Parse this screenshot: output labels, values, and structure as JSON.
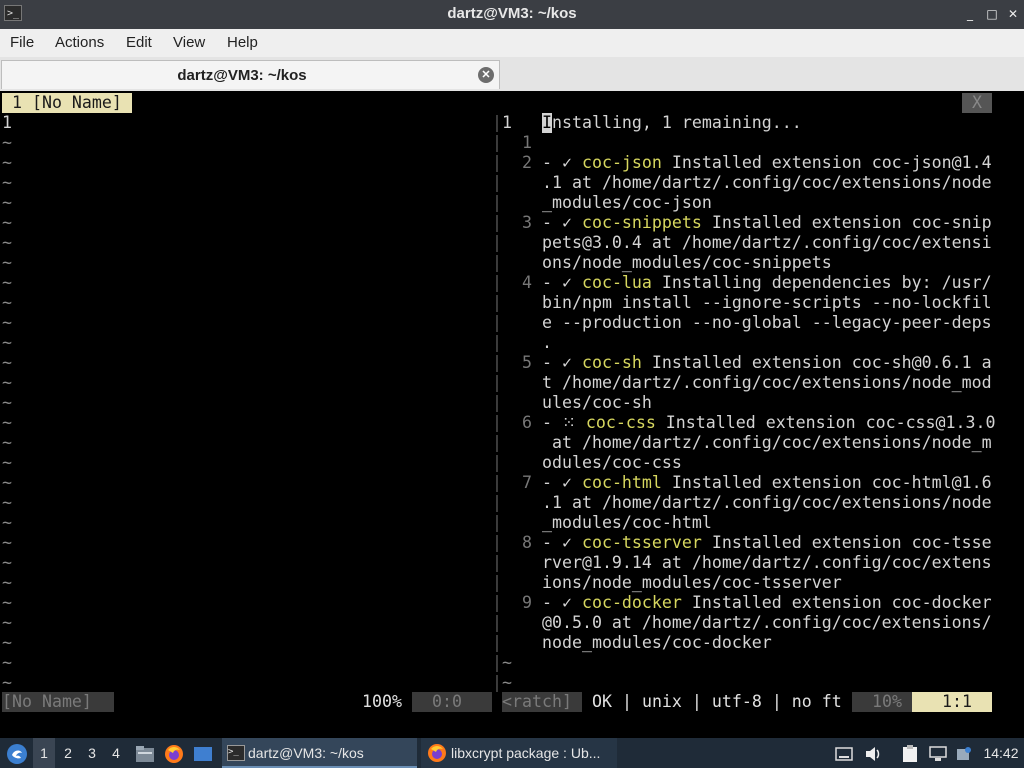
{
  "window": {
    "title": "dartz@VM3: ~/kos",
    "app_icon": "terminal-icon",
    "buttons": {
      "minimize": "_",
      "maximize": "□",
      "close": "✕"
    }
  },
  "menu": [
    "File",
    "Actions",
    "Edit",
    "View",
    "Help"
  ],
  "tab": {
    "label": "dartz@VM3: ~/kos",
    "close": "✕"
  },
  "vim": {
    "tabline": {
      "active": " 1 [No Name] ",
      "close": "X"
    },
    "left_first_line": "1",
    "tilde": "~",
    "sep": "|",
    "right_lines": [
      {
        "num": "1",
        "text": "nstalling, 1 remaining...",
        "cursor_char": "I"
      },
      {
        "num": "1"
      },
      {
        "num": "2",
        "ext": "coc-json",
        "rest1": " Installed extension coc-json@1.4",
        "cont": [
          ".1 at /home/dartz/.config/coc/extensions/node",
          "_modules/coc-json"
        ]
      },
      {
        "num": "3",
        "ext": "coc-snippets",
        "rest1": " Installed extension coc-snip",
        "cont": [
          "pets@3.0.4 at /home/dartz/.config/coc/extensi",
          "ons/node_modules/coc-snippets"
        ]
      },
      {
        "num": "4",
        "ext": "coc-lua",
        "rest1": " Installing dependencies by: /usr/",
        "cont": [
          "bin/npm install --ignore-scripts --no-lockfil",
          "e --production --no-global --legacy-peer-deps",
          "."
        ]
      },
      {
        "num": "5",
        "ext": "coc-sh",
        "rest1": " Installed extension coc-sh@0.6.1 a",
        "cont": [
          "t /home/dartz/.config/coc/extensions/node_mod",
          "ules/coc-sh"
        ]
      },
      {
        "num": "6",
        "ext": "coc-css",
        "rest1": " Installed extension coc-css@1.3.0",
        "cont": [
          " at /home/dartz/.config/coc/extensions/node_m",
          "odules/coc-css"
        ]
      },
      {
        "num": "7",
        "ext": "coc-html",
        "rest1": " Installed extension coc-html@1.6",
        "cont": [
          ".1 at /home/dartz/.config/coc/extensions/node",
          "_modules/coc-html"
        ]
      },
      {
        "num": "8",
        "ext": "coc-tsserver",
        "rest1": " Installed extension coc-tsse",
        "cont": [
          "rver@1.9.14 at /home/dartz/.config/coc/extens",
          "ions/node_modules/coc-tsserver"
        ]
      },
      {
        "num": "9",
        "ext": "coc-docker",
        "rest1": " Installed extension coc-docker",
        "cont": [
          "@0.5.0 at /home/dartz/.config/coc/extensions/",
          "node_modules/coc-docker"
        ]
      }
    ],
    "statusline": {
      "left_name": "[No Name] ",
      "left_pct": "100%",
      "left_pos": "  0:0 ",
      "right_name": "<ratch] ",
      "right_info": "OK | unix | utf-8 | no ft",
      "right_pct": "  10% ",
      "right_pos": "   1:1 "
    }
  },
  "taskbar": {
    "start_icon": "distro-menu-icon",
    "workspaces": [
      "1",
      "2",
      "3",
      "4"
    ],
    "launchers": [
      "file-manager-icon",
      "firefox-icon",
      "show-desktop-icon"
    ],
    "tasks": [
      {
        "label": "dartz@VM3: ~/kos",
        "icon": "terminal-icon",
        "active": true
      },
      {
        "label": "libxcrypt package : Ub...",
        "icon": "firefox-icon",
        "active": false
      }
    ],
    "tray": [
      "keyboard-icon",
      "volume-icon",
      "clipboard-icon",
      "network-icon"
    ],
    "clock": "14:42"
  }
}
